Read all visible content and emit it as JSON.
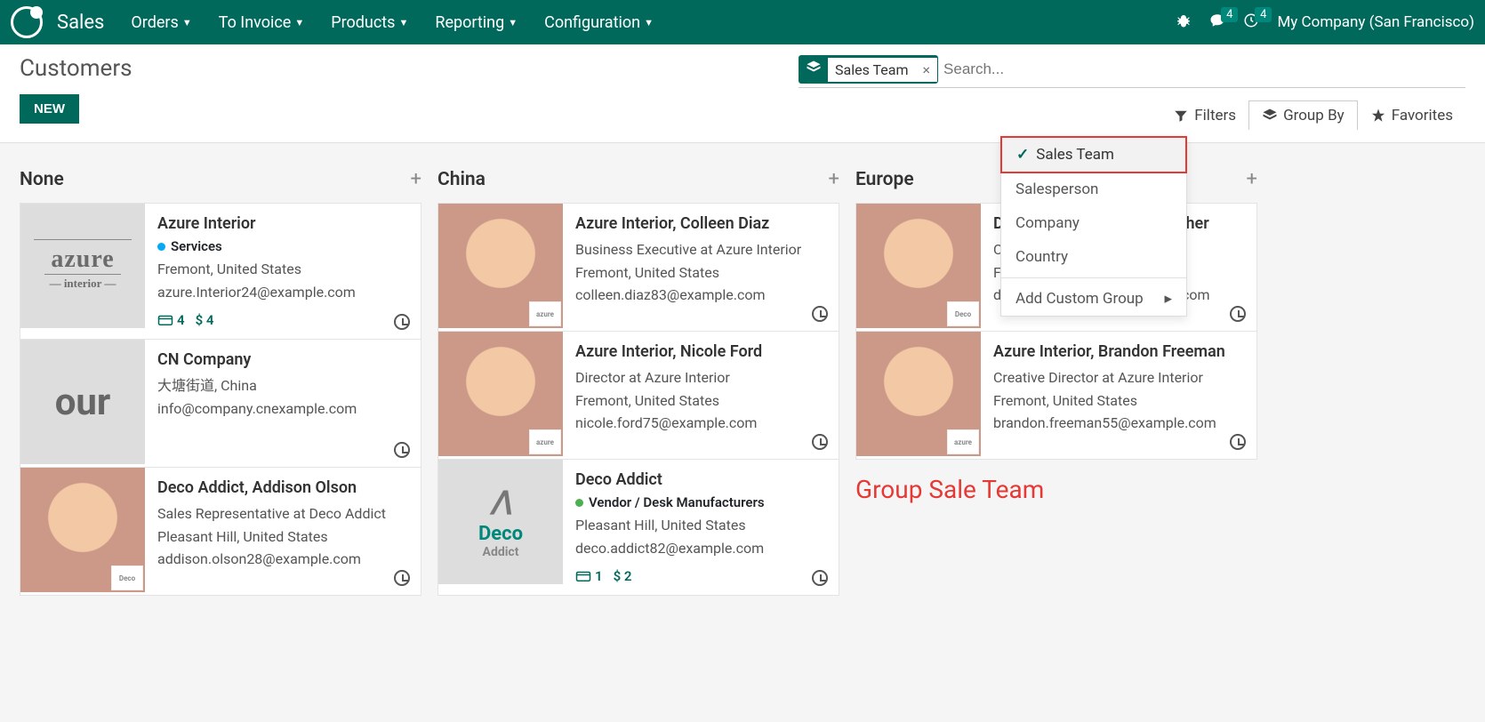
{
  "nav": {
    "brand": "Sales",
    "items": [
      "Orders",
      "To Invoice",
      "Products",
      "Reporting",
      "Configuration"
    ],
    "msg_badge": "4",
    "activity_badge": "4",
    "company": "My Company (San Francisco)"
  },
  "header": {
    "title": "Customers",
    "new_btn": "NEW",
    "chip_label": "Sales Team",
    "search_placeholder": "Search...",
    "filters": "Filters",
    "group_by": "Group By",
    "favorites": "Favorites"
  },
  "groupby_menu": {
    "items": [
      "Sales Team",
      "Salesperson",
      "Company",
      "Country"
    ],
    "custom": "Add Custom Group"
  },
  "columns": [
    {
      "title": "None",
      "cards": [
        {
          "name": "Azure Interior",
          "tag_color": "blue",
          "tag": "Services",
          "loc": "Fremont, United States",
          "email": "azure.Interior24@example.com",
          "cc": "4",
          "amount": "$ 4",
          "img_kind": "azure-logo"
        },
        {
          "name": "CN Company",
          "sub": "大塘街道, China",
          "email": "info@company.cnexample.com",
          "img_kind": "text",
          "img_text": "our"
        },
        {
          "name": "Deco Addict, Addison Olson",
          "role": "Sales Representative at Deco Addict",
          "loc": "Pleasant Hill, United States",
          "email": "addison.olson28@example.com",
          "img_kind": "face",
          "mini": "deco"
        }
      ]
    },
    {
      "title": "China",
      "cards": [
        {
          "name": "Azure Interior, Colleen Diaz",
          "role": "Business Executive at Azure Interior",
          "loc": "Fremont, United States",
          "email": "colleen.diaz83@example.com",
          "img_kind": "face",
          "mini": "azure"
        },
        {
          "name": "Azure Interior, Nicole Ford",
          "role": "Director at Azure Interior",
          "loc": "Fremont, United States",
          "email": "nicole.ford75@example.com",
          "img_kind": "face",
          "mini": "azure"
        },
        {
          "name": "Deco Addict",
          "tag_color": "green",
          "tag": "Vendor / Desk Manufacturers",
          "loc": "Pleasant Hill, United States",
          "email": "deco.addict82@example.com",
          "cc": "1",
          "amount": "$ 2",
          "img_kind": "deco-logo"
        }
      ]
    },
    {
      "title": "Europe",
      "cards": [
        {
          "name": "Deco Addict, Douglas Fletcher",
          "role": "Consultant at Deco",
          "loc": "Fremont, United States",
          "email": "douglas.fletcher51@example.com",
          "img_kind": "face",
          "mini": "deco"
        },
        {
          "name": "Azure Interior, Brandon Freeman",
          "role": "Creative Director at Azure Interior",
          "loc": "Fremont, United States",
          "email": "brandon.freeman55@example.com",
          "img_kind": "face",
          "mini": "azure"
        }
      ]
    }
  ],
  "annotation": "Group Sale Team"
}
